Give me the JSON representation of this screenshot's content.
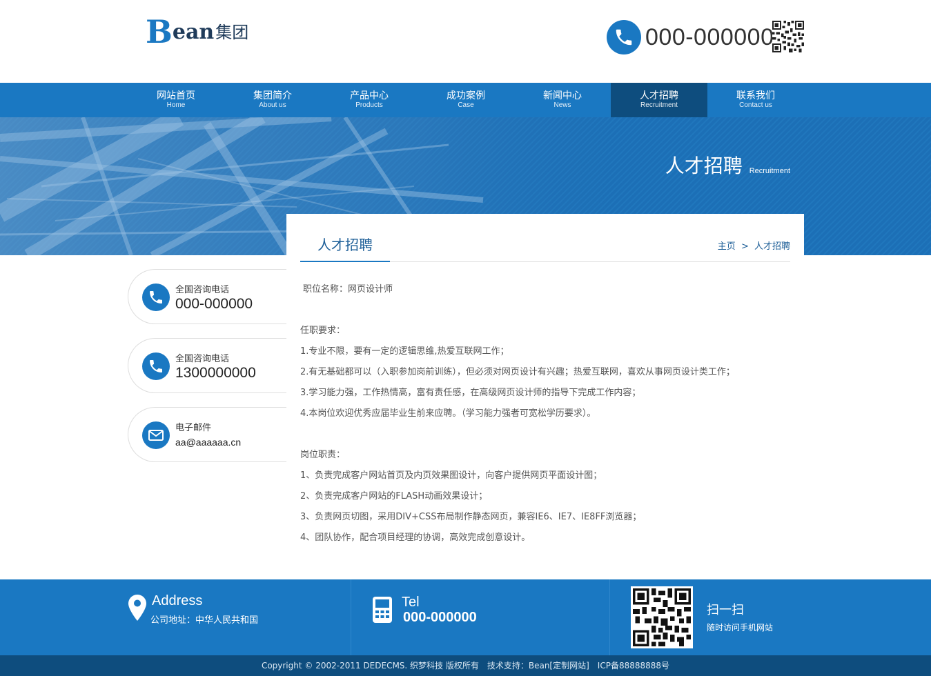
{
  "header": {
    "logo_brand_initial": "B",
    "logo_brand_rest": "ean",
    "logo_group": "集团",
    "hotline": "000-000000"
  },
  "nav": {
    "items": [
      {
        "cn": "网站首页",
        "en": "Home"
      },
      {
        "cn": "集团简介",
        "en": "About us"
      },
      {
        "cn": "产品中心",
        "en": "Products"
      },
      {
        "cn": "成功案例",
        "en": "Case"
      },
      {
        "cn": "新闻中心",
        "en": "News"
      },
      {
        "cn": "人才招聘",
        "en": "Recruitment",
        "active": true
      },
      {
        "cn": "联系我们",
        "en": "Contact us"
      }
    ]
  },
  "banner": {
    "title_cn": "人才招聘",
    "title_en": "Recruitment"
  },
  "content": {
    "title": "人才招聘",
    "breadcrumb": {
      "home": "主页",
      "separator": ">",
      "current": "人才招聘"
    },
    "position_line": "职位名称：网页设计师",
    "requirements_heading": "任职要求：",
    "requirements": [
      "1.专业不限，要有一定的逻辑思维,热爱互联网工作；",
      "2.有无基础都可以（入职参加岗前训练），但必须对网页设计有兴趣；热爱互联网，喜欢从事网页设计类工作；",
      "3.学习能力强，工作热情高，富有责任感，在高级网页设计师的指导下完成工作内容；",
      "4.本岗位欢迎优秀应届毕业生前来应聘。（学习能力强者可宽松学历要求）。"
    ],
    "duties_heading": "岗位职责：",
    "duties": [
      "1、负责完成客户网站首页及内页效果图设计，向客户提供网页平面设计图；",
      "2、负责完成客户网站的FLASH动画效果设计；",
      "3、负责网页切图，采用DIV+CSS布局制作静态网页，兼容IE6、IE7、IE8FF浏览器；",
      "4、团队协作，配合项目经理的协调，高效完成创意设计。"
    ]
  },
  "sidebar": {
    "cards": [
      {
        "label": "全国咨询电话",
        "value": "000-000000",
        "icon": "phone-icon"
      },
      {
        "label": "全国咨询电话",
        "value": "1300000000",
        "icon": "phone-icon"
      },
      {
        "label": "电子邮件",
        "value": "aa@aaaaaa.cn",
        "icon": "mail-icon"
      }
    ]
  },
  "footer": {
    "address_title": "Address",
    "address": "公司地址：中华人民共和国",
    "tel_title": "Tel",
    "tel": "000-000000",
    "scan_title": "扫一扫",
    "scan_sub": "随时访问手机网站",
    "copyright": "Copyright © 2002-2011 DEDECMS. 织梦科技 版权所有　技术支持：Bean[定制网站]　ICP备88888888号"
  },
  "colors": {
    "primary": "#1a78c2",
    "dark": "#0e4d7e",
    "title_blue": "#1a5c96"
  }
}
